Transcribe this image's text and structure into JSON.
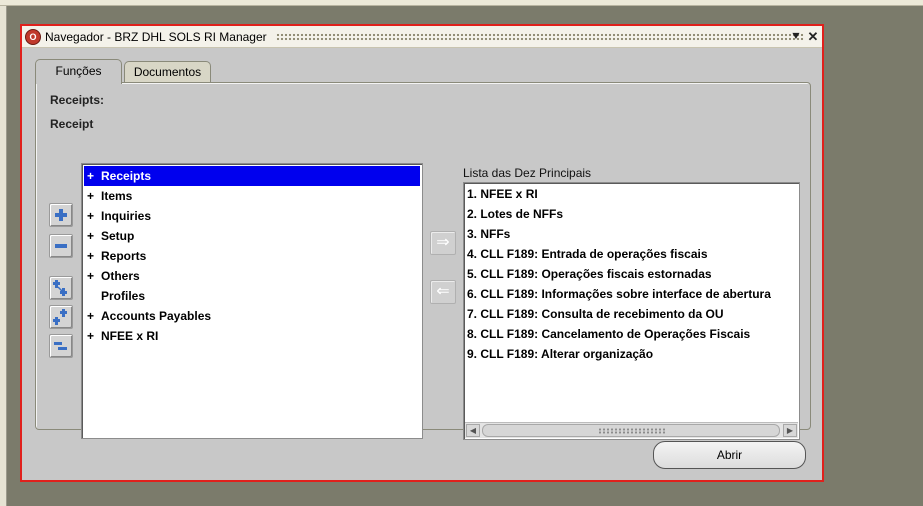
{
  "window": {
    "title": "Navegador - BRZ DHL SOLS RI Manager",
    "min_glyph": "⯆",
    "close_glyph": "✕",
    "icon_glyph": "O"
  },
  "tabs": [
    {
      "label": "Funções",
      "active": true
    },
    {
      "label": "Documentos",
      "active": false
    }
  ],
  "panel": {
    "heading": "Receipts:",
    "subheading": "Receipt"
  },
  "controls": [
    {
      "icon": "plus-icon"
    },
    {
      "icon": "minus-icon"
    },
    {
      "icon": "expand-branch-icon"
    },
    {
      "icon": "expand-all-icon"
    },
    {
      "icon": "collapse-all-icon"
    }
  ],
  "tree": {
    "items": [
      {
        "label": "Receipts",
        "exp": "+",
        "selected": true
      },
      {
        "label": "Items",
        "exp": "+"
      },
      {
        "label": "Inquiries",
        "exp": "+"
      },
      {
        "label": "Setup",
        "exp": "+"
      },
      {
        "label": "Reports",
        "exp": "+"
      },
      {
        "label": "Others",
        "exp": "+"
      },
      {
        "label": "Profiles",
        "exp": ""
      },
      {
        "label": "Accounts Payables",
        "exp": "+"
      },
      {
        "label": "NFEE x RI",
        "exp": "+"
      }
    ]
  },
  "move_buttons": {
    "add": "⇒",
    "remove": "⇐"
  },
  "lista": {
    "label": "Lista das Dez Principais",
    "items": [
      "1. NFEE x RI",
      "2. Lotes de NFFs",
      "3. NFFs",
      "4. CLL F189: Entrada de operações fiscais",
      "5. CLL F189: Operações fiscais estornadas",
      "6. CLL F189: Informações sobre interface de abertura",
      "7. CLL F189: Consulta de recebimento da OU",
      "8. CLL F189: Cancelamento de Operações Fiscais",
      "9. CLL F189: Alterar organização"
    ],
    "scroll_left": "◀",
    "scroll_right": "▶"
  },
  "abrir_label": "Abrir",
  "colors": {
    "selection": "#0000ee",
    "window_border": "#e0201c",
    "desktop": "#7b7b6b"
  }
}
